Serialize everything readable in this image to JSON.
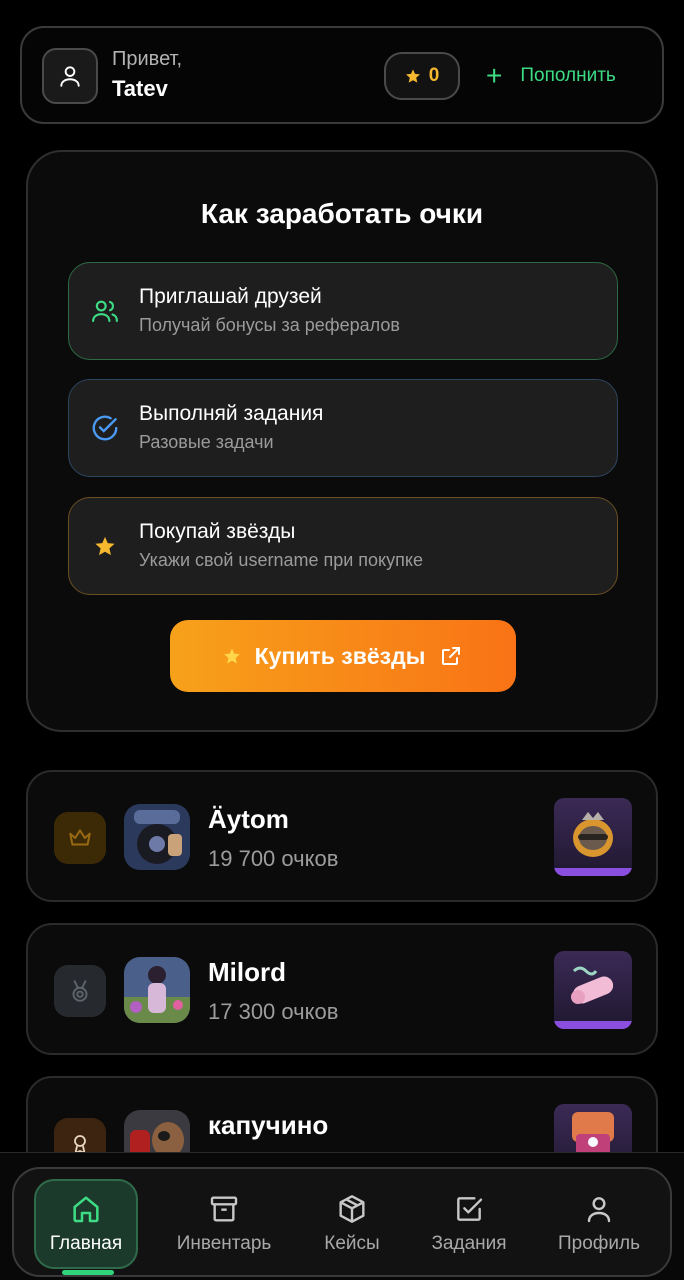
{
  "header": {
    "greeting": "Привет,",
    "username": "Tatev",
    "balance": "0",
    "topup_label": "Пополнить"
  },
  "earn": {
    "title": "Как заработать очки",
    "ways": [
      {
        "title": "Приглашай друзей",
        "subtitle": "Получай бонусы за рефералов",
        "icon": "users-icon"
      },
      {
        "title": "Выполняй задания",
        "subtitle": "Разовые задачи",
        "icon": "check-circle-icon"
      },
      {
        "title": "Покупай звёзды",
        "subtitle": "Укажи свой username при покупке",
        "icon": "star-icon"
      }
    ],
    "buy_button": "Купить звёзды"
  },
  "leaderboard": [
    {
      "rank_icon": "crown-icon",
      "name": "Äytom",
      "score": "19 700 очков"
    },
    {
      "rank_icon": "medal-icon",
      "name": "Milord",
      "score": "17 300 очков"
    },
    {
      "rank_icon": "award-icon",
      "name": "капучино",
      "score": ""
    }
  ],
  "nav": [
    {
      "label": "Главная",
      "icon": "home-icon",
      "active": true
    },
    {
      "label": "Инвентарь",
      "icon": "archive-icon"
    },
    {
      "label": "Кейсы",
      "icon": "box-icon"
    },
    {
      "label": "Задания",
      "icon": "checkbox-icon"
    },
    {
      "label": "Профиль",
      "icon": "user-icon"
    }
  ],
  "colors": {
    "accent_green": "#3ddc84",
    "accent_orange": "#f97316",
    "star_gold": "#f5b82e"
  }
}
